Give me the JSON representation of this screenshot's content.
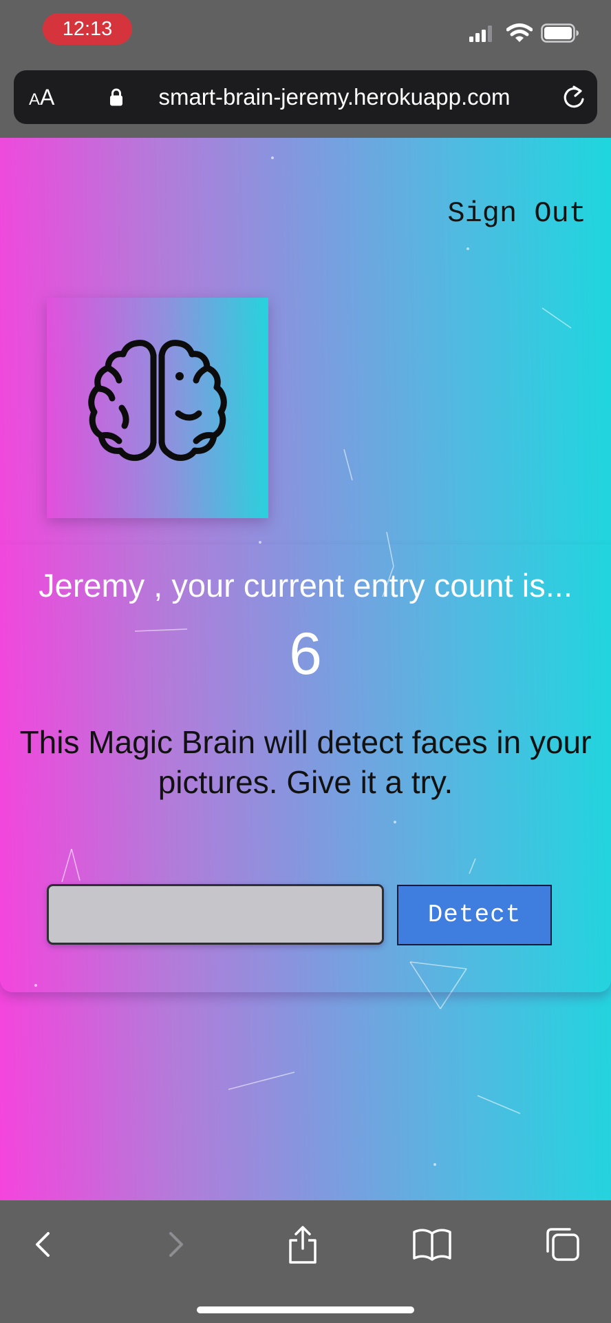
{
  "status_bar": {
    "time": "12:13",
    "time_pill_color": "#d6343d",
    "signal_bars_active": 3,
    "icons": [
      "signal-icon",
      "wifi-icon",
      "battery-icon"
    ]
  },
  "browser": {
    "text_size_label_small": "A",
    "text_size_label_large": "A",
    "url": "smart-brain-jeremy.herokuapp.com",
    "icons": [
      "lock-icon",
      "reload-icon"
    ]
  },
  "page": {
    "sign_out": "Sign Out",
    "logo_icon": "brain-icon",
    "entry_text": "Jeremy , your current entry count is...",
    "entry_count": "6",
    "description": "This Magic Brain will detect faces in your pictures. Give it a try.",
    "input_placeholder": "",
    "input_value": "",
    "detect_button": "Detect",
    "colors": {
      "gradient_left": "#f544dc",
      "gradient_right": "#1ed6de",
      "detect_button": "#3f7edf",
      "input_background": "#c6c6ca"
    }
  },
  "toolbar": {
    "items": [
      "back-icon",
      "forward-icon",
      "share-icon",
      "bookmarks-icon",
      "tabs-icon"
    ],
    "forward_enabled": false
  }
}
